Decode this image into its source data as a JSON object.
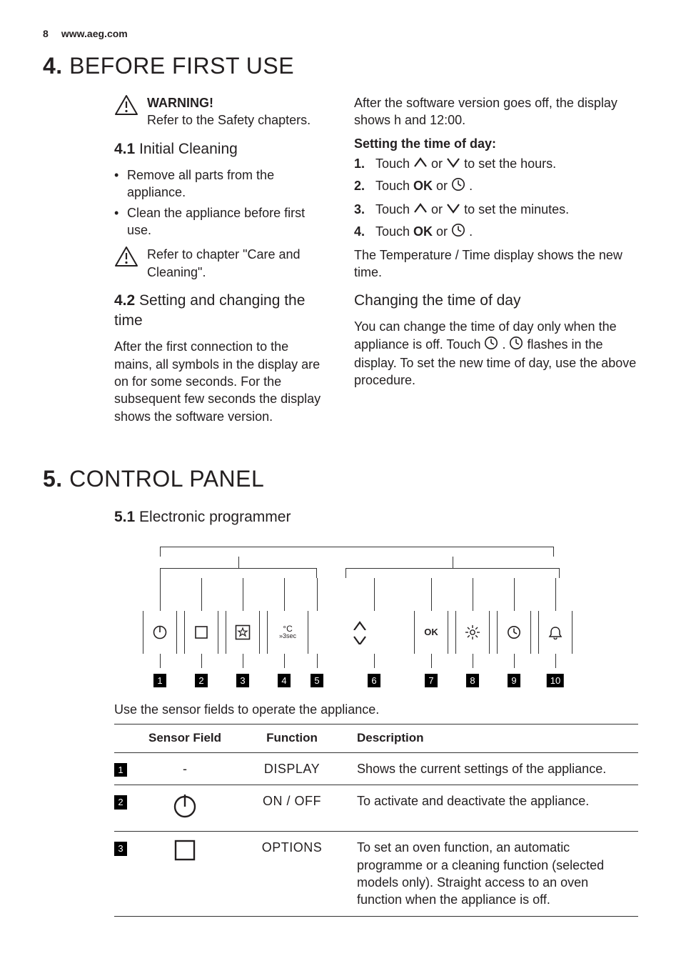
{
  "page": {
    "number": "8",
    "site": "www.aeg.com"
  },
  "s4": {
    "number": "4.",
    "title": "BEFORE FIRST USE",
    "warn": {
      "title": "WARNING!",
      "text": "Refer to the Safety chapters."
    },
    "s41": {
      "num": "4.1",
      "title": "Initial Cleaning",
      "b1": "Remove all parts from the appliance.",
      "b2": "Clean the appliance before first use.",
      "note": "Refer to chapter \"Care and Cleaning\"."
    },
    "s42": {
      "num": "4.2",
      "title": "Setting and changing the time",
      "para": "After the first connection to the mains, all symbols in the display are on for some seconds. For the subsequent few seconds the display shows the software version."
    },
    "right": {
      "intro": "After the software version goes off, the display shows h and 12:00.",
      "settingHead": "Setting the time of day:",
      "st1a": "Touch ",
      "st1b": " or ",
      "st1c": " to set the hours.",
      "st2a": "Touch ",
      "st2b": " or ",
      "st2c": " .",
      "st3a": "Touch ",
      "st3b": " or ",
      "st3c": " to set the minutes.",
      "st4a": "Touch ",
      "st4b": " or ",
      "st4c": " .",
      "after": "The Temperature / Time display shows the new time.",
      "changeHead": "Changing the time of day",
      "cp1a": "You can change the time of day only when the appliance is off. Touch ",
      "cp1b": " . ",
      "cp1c": " flashes in the display. To set the new time of day, use the above procedure."
    }
  },
  "s5": {
    "number": "5.",
    "title": "CONTROL PANEL",
    "s51": {
      "num": "5.1",
      "title": "Electronic programmer"
    },
    "tags": [
      "1",
      "2",
      "3",
      "4",
      "5",
      "6",
      "7",
      "8",
      "9",
      "10"
    ],
    "useText": "Use the sensor fields to operate the appliance.",
    "table": {
      "h1": "Sensor Field",
      "h2": "Function",
      "h3": "Description",
      "rows": [
        {
          "n": "1",
          "sf": "-",
          "fn": "DISPLAY",
          "desc": "Shows the current settings of the appliance."
        },
        {
          "n": "2",
          "sf": "power-icon",
          "fn": "ON / OFF",
          "desc": "To activate and deactivate the appliance."
        },
        {
          "n": "3",
          "sf": "options-icon",
          "fn": "OPTIONS",
          "desc": "To set an oven function, an automatic programme or a cleaning function (selected models only). Straight access to an oven function when the appliance is off."
        }
      ]
    }
  },
  "ok": "OK"
}
